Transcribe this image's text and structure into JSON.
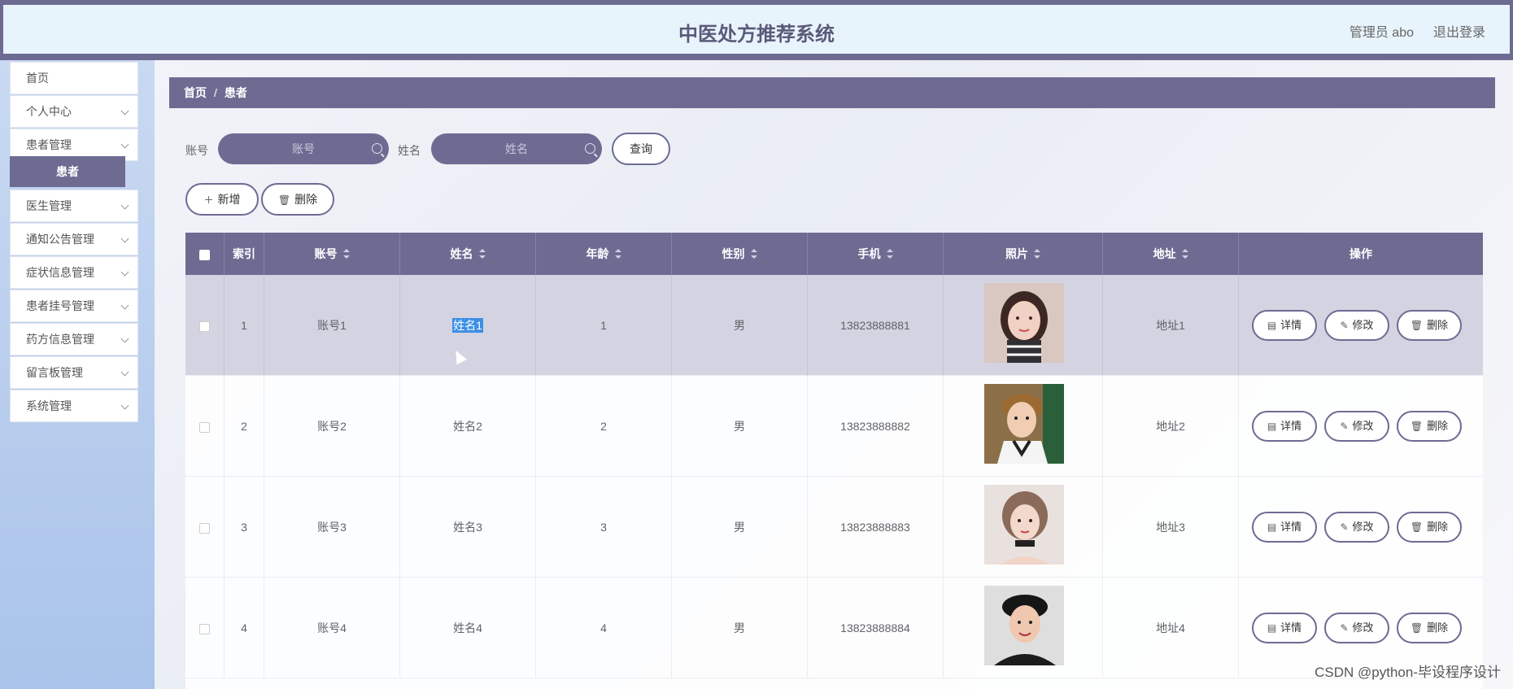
{
  "header": {
    "title": "中医处方推荐系统",
    "user": "管理员 abo",
    "logout": "退出登录"
  },
  "sidebar": {
    "items": [
      {
        "label": "首页",
        "has_children": false
      },
      {
        "label": "个人中心",
        "has_children": true
      },
      {
        "label": "患者管理",
        "has_children": true
      },
      {
        "label": "医生管理",
        "has_children": true
      },
      {
        "label": "通知公告管理",
        "has_children": true
      },
      {
        "label": "症状信息管理",
        "has_children": true
      },
      {
        "label": "患者挂号管理",
        "has_children": true
      },
      {
        "label": "药方信息管理",
        "has_children": true
      },
      {
        "label": "留言板管理",
        "has_children": true
      },
      {
        "label": "系统管理",
        "has_children": true
      }
    ],
    "active_submenu": "患者"
  },
  "breadcrumb": {
    "home": "首页",
    "separator": "/",
    "current": "患者"
  },
  "search": {
    "account_label": "账号",
    "account_placeholder": "账号",
    "name_label": "姓名",
    "name_placeholder": "姓名",
    "query_button": "查询"
  },
  "toolbar": {
    "add_label": "新增",
    "delete_label": "删除"
  },
  "table": {
    "headers": {
      "index": "索引",
      "account": "账号",
      "name": "姓名",
      "age": "年龄",
      "gender": "性别",
      "phone": "手机",
      "photo": "照片",
      "address": "地址",
      "actions": "操作"
    },
    "rows": [
      {
        "index": "1",
        "account": "账号1",
        "name": "姓名1",
        "age": "1",
        "gender": "男",
        "phone": "13823888881",
        "address": "地址1",
        "photo_icon": "female-portrait",
        "selected": true
      },
      {
        "index": "2",
        "account": "账号2",
        "name": "姓名2",
        "age": "2",
        "gender": "男",
        "phone": "13823888882",
        "address": "地址2",
        "photo_icon": "male-portrait"
      },
      {
        "index": "3",
        "account": "账号3",
        "name": "姓名3",
        "age": "3",
        "gender": "男",
        "phone": "13823888883",
        "address": "地址3",
        "photo_icon": "female-portrait"
      },
      {
        "index": "4",
        "account": "账号4",
        "name": "姓名4",
        "age": "4",
        "gender": "男",
        "phone": "13823888884",
        "address": "地址4",
        "photo_icon": "male-portrait"
      }
    ],
    "action_labels": {
      "detail": "详情",
      "edit": "修改",
      "delete": "删除"
    }
  },
  "watermark": "CSDN @python-毕设程序设计",
  "colors": {
    "accent": "#6e6b93",
    "sidebar": "#b7cdee",
    "selection": "#3b8fe6"
  }
}
